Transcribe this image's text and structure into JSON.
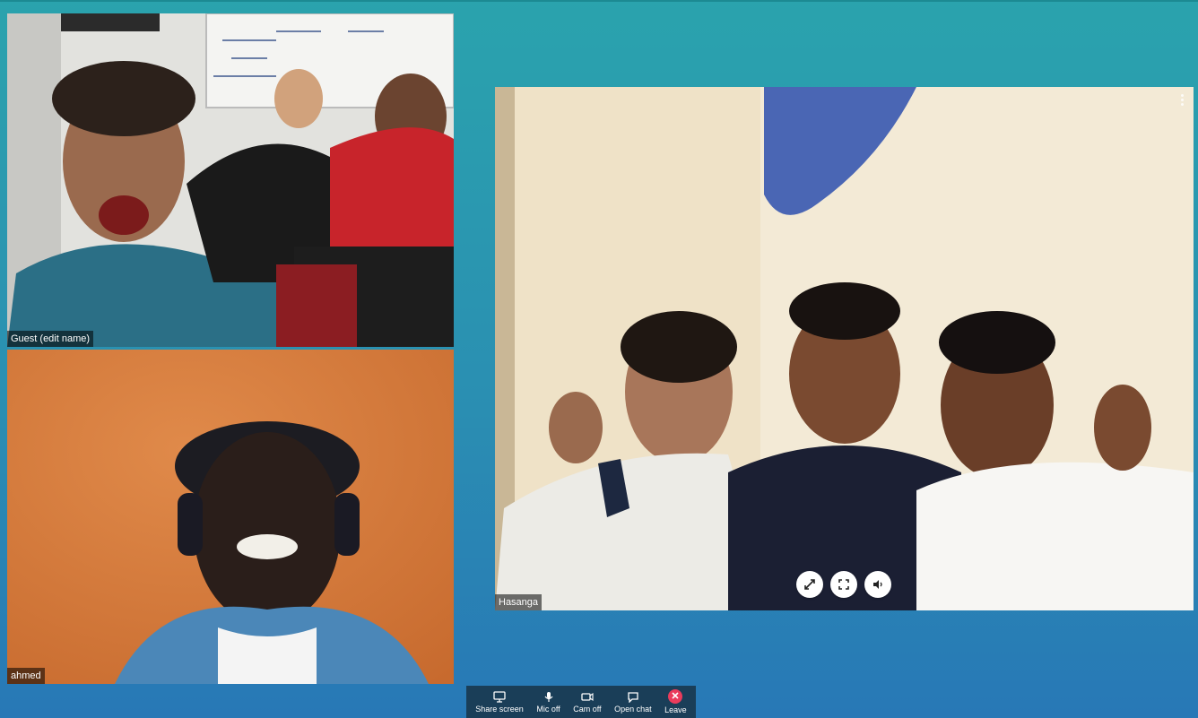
{
  "participants": [
    {
      "name": "Guest (edit name)"
    },
    {
      "name": "ahmed"
    },
    {
      "name": "Hasanga"
    }
  ],
  "toolbar": {
    "share_screen": "Share screen",
    "mic_off": "Mic off",
    "cam_off": "Cam off",
    "open_chat": "Open chat",
    "leave": "Leave"
  },
  "colors": {
    "background_top": "#2aa3ad",
    "background_bottom": "#2878b6",
    "toolbar_bg": "#1a3e58",
    "leave_accent": "#ea3c5c"
  },
  "icons": [
    "monitor-icon",
    "microphone-icon",
    "camera-icon",
    "chat-icon",
    "close-icon",
    "expand-icon",
    "fullscreen-icon",
    "volume-icon",
    "more-options-icon"
  ]
}
